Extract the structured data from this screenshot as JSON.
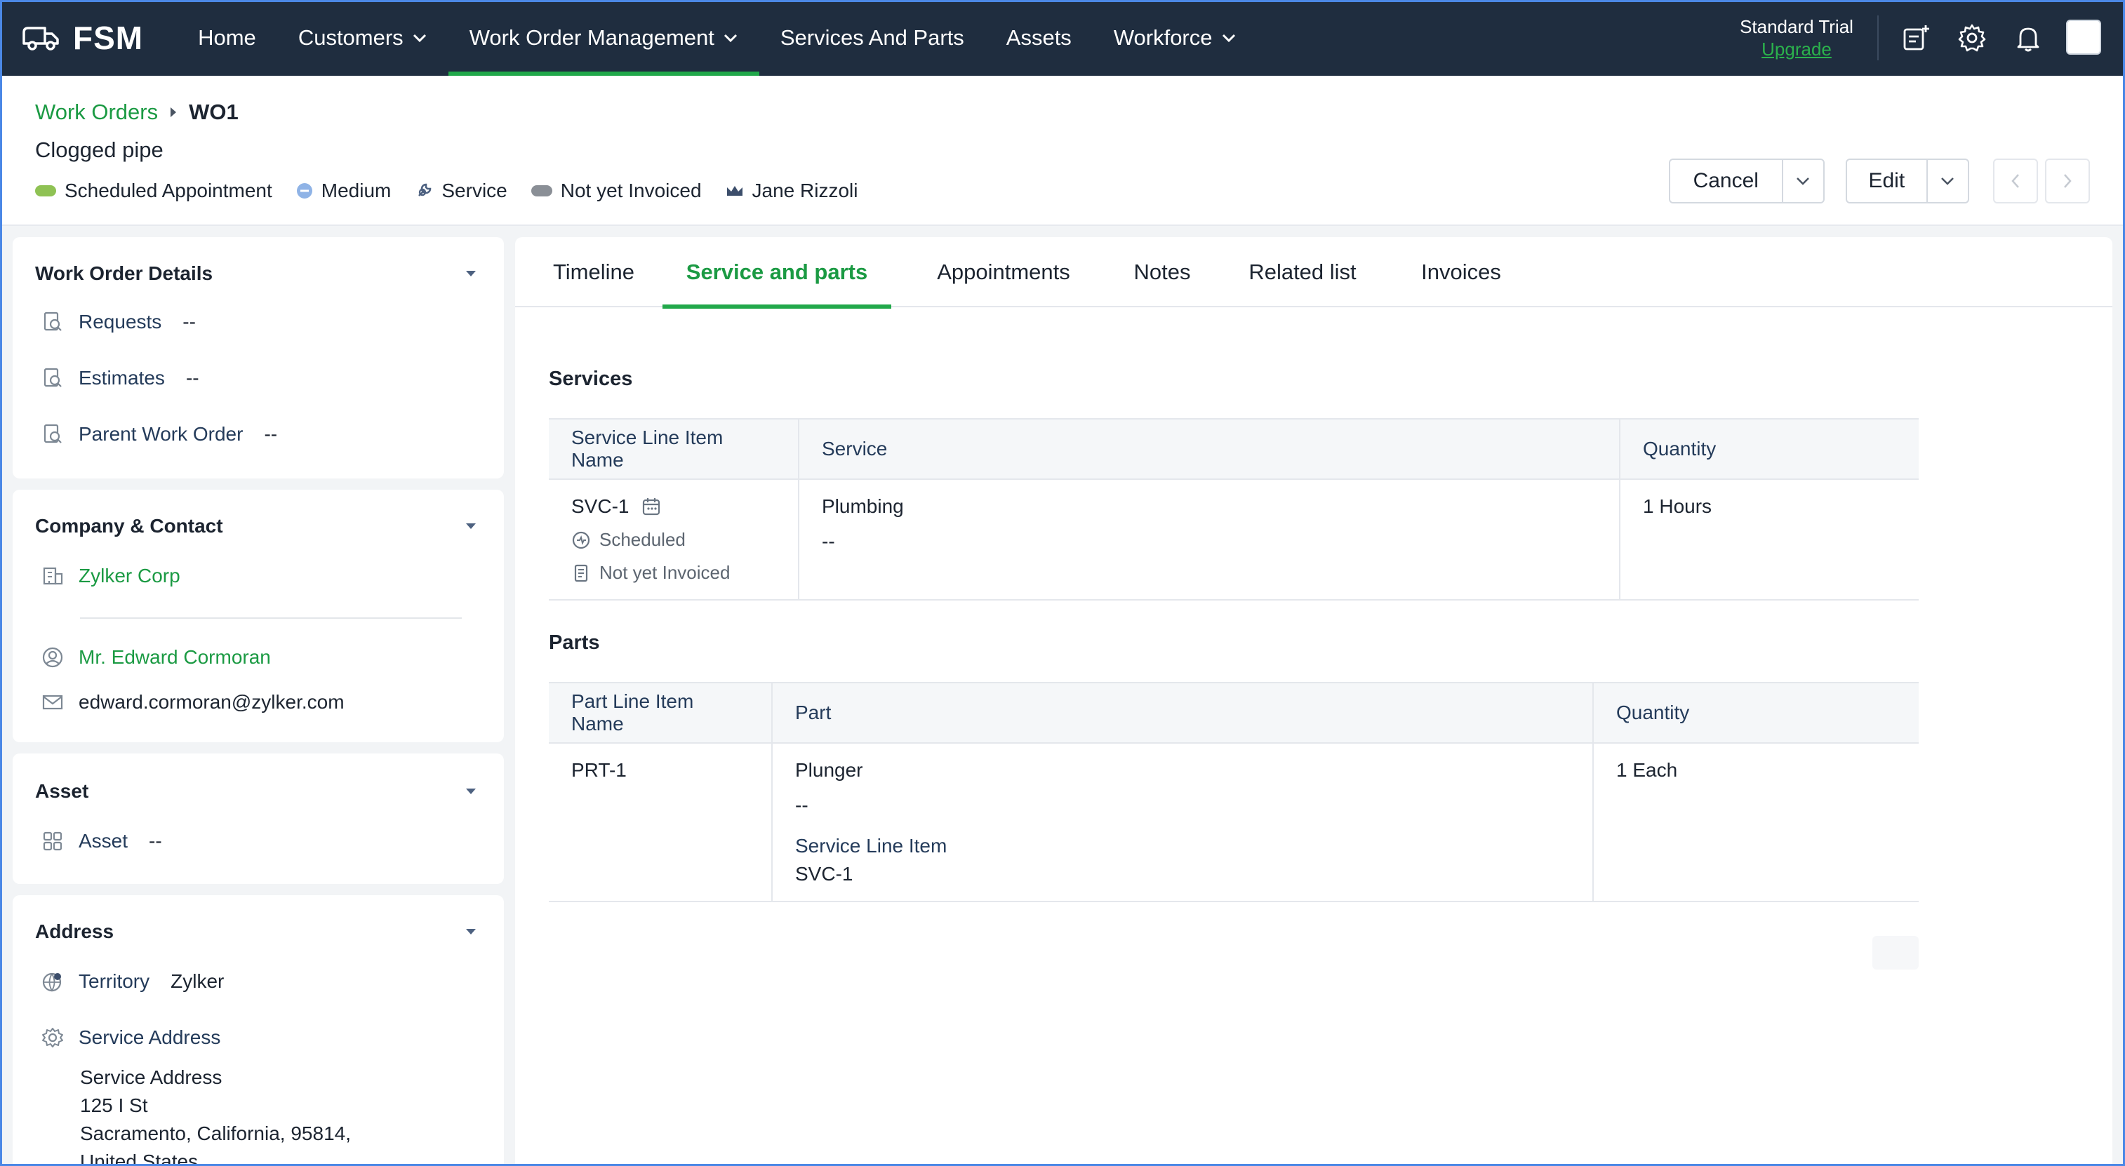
{
  "app": {
    "name": "FSM"
  },
  "nav": {
    "items": [
      {
        "label": "Home",
        "dropdown": false
      },
      {
        "label": "Customers",
        "dropdown": true
      },
      {
        "label": "Work Order Management",
        "dropdown": true,
        "active": true
      },
      {
        "label": "Services And Parts",
        "dropdown": false
      },
      {
        "label": "Assets",
        "dropdown": false
      },
      {
        "label": "Workforce",
        "dropdown": true
      }
    ],
    "trial_label": "Standard Trial",
    "upgrade_label": "Upgrade"
  },
  "header": {
    "breadcrumb_root": "Work Orders",
    "breadcrumb_current": "WO1",
    "title": "Clogged pipe",
    "tags": {
      "status": "Scheduled Appointment",
      "priority": "Medium",
      "type": "Service",
      "billing": "Not yet Invoiced",
      "owner": "Jane Rizzoli"
    },
    "cancel_label": "Cancel",
    "edit_label": "Edit"
  },
  "details": {
    "title": "Work Order Details",
    "requests_label": "Requests",
    "requests_value": "--",
    "estimates_label": "Estimates",
    "estimates_value": "--",
    "parent_label": "Parent Work Order",
    "parent_value": "--"
  },
  "company": {
    "title": "Company & Contact",
    "company_name": "Zylker Corp",
    "contact_name": "Mr. Edward Cormoran",
    "email": "edward.cormoran@zylker.com"
  },
  "asset": {
    "title": "Asset",
    "label": "Asset",
    "value": "--"
  },
  "address": {
    "title": "Address",
    "territory_label": "Territory",
    "territory_value": "Zylker",
    "service_address_label": "Service Address",
    "line1": "Service Address",
    "line2": "125 I St",
    "line3": "Sacramento, California, 95814,",
    "line4": "United States"
  },
  "tabs": [
    "Timeline",
    "Service and parts",
    "Appointments",
    "Notes",
    "Related list",
    "Invoices"
  ],
  "services": {
    "title": "Services",
    "columns": [
      "Service Line Item Name",
      "Service",
      "Quantity"
    ],
    "row": {
      "name": "SVC-1",
      "status": "Scheduled",
      "billing": "Not yet Invoiced",
      "service": "Plumbing",
      "service_desc": "--",
      "quantity": "1 Hours"
    }
  },
  "parts": {
    "title": "Parts",
    "columns": [
      "Part Line Item Name",
      "Part",
      "Quantity"
    ],
    "row": {
      "name": "PRT-1",
      "part": "Plunger",
      "part_desc": "--",
      "sli_label": "Service Line Item",
      "sli_value": "SVC-1",
      "quantity": "1 Each"
    }
  },
  "colors": {
    "nav_bg": "#1f2d3f",
    "accent": "#21a84a",
    "link": "#1b9a43"
  }
}
